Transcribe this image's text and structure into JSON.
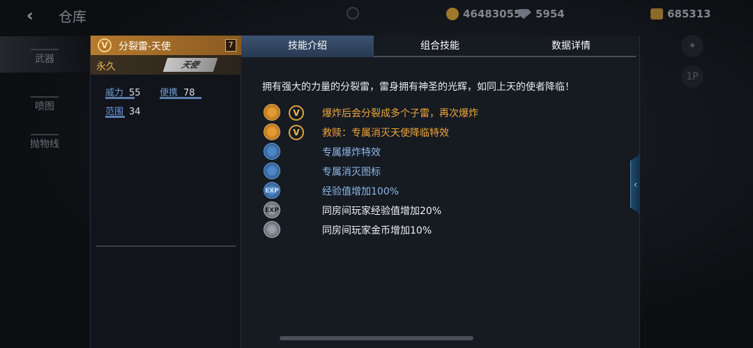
{
  "topbar": {
    "title": "仓库",
    "currency": [
      {
        "icon": "coin-icon",
        "value": "46483055"
      },
      {
        "icon": "diamond-icon",
        "value": "5954"
      },
      {
        "icon": "gold-icon",
        "value": "685313"
      }
    ]
  },
  "nav": {
    "items": [
      {
        "label": "武器",
        "icon": "rifle-icon"
      },
      {
        "label": "喷图",
        "icon": "spray-icon"
      },
      {
        "label": "抛物线",
        "icon": "arc-icon"
      }
    ]
  },
  "right_controls": {
    "player_label": "1P"
  },
  "weapon": {
    "rank": "7",
    "name": "分裂雷-天使",
    "duration": "永久",
    "tag": "天使",
    "stats": [
      {
        "label": "威力",
        "value": "55"
      },
      {
        "label": "便携",
        "value": "78"
      },
      {
        "label": "范围",
        "value": "34"
      }
    ]
  },
  "tabs": [
    {
      "label": "技能介绍",
      "active": true
    },
    {
      "label": "组合技能",
      "active": false
    },
    {
      "label": "数据详情",
      "active": false
    }
  ],
  "description": "拥有强大的力量的分裂雷，雷身拥有神圣的光辉，如同上天的使者降临！",
  "skills": [
    {
      "icon": "explosion-icon",
      "text": "爆炸后会分裂成多个子雷，再次爆炸",
      "vip": true,
      "color": "orange"
    },
    {
      "icon": "redemption-icon",
      "text": "救赎：专属消灭天使降临特效",
      "vip": true,
      "color": "orange"
    },
    {
      "icon": "blast-effect-icon",
      "text": "专属爆炸特效",
      "vip": false,
      "color": "blue"
    },
    {
      "icon": "kill-mark-icon",
      "text": "专属消灭图标",
      "vip": false,
      "color": "blue"
    },
    {
      "icon": "exp-icon",
      "text": "经验值增加100%",
      "vip": false,
      "color": "blue"
    },
    {
      "icon": "room-exp-icon",
      "text": "同房间玩家经验值增加20%",
      "vip": false,
      "color": "white"
    },
    {
      "icon": "room-coin-icon",
      "text": "同房间玩家金币增加10%",
      "vip": false,
      "color": "white"
    }
  ],
  "icon_text": {
    "exp": "EXP",
    "vip": "V"
  }
}
